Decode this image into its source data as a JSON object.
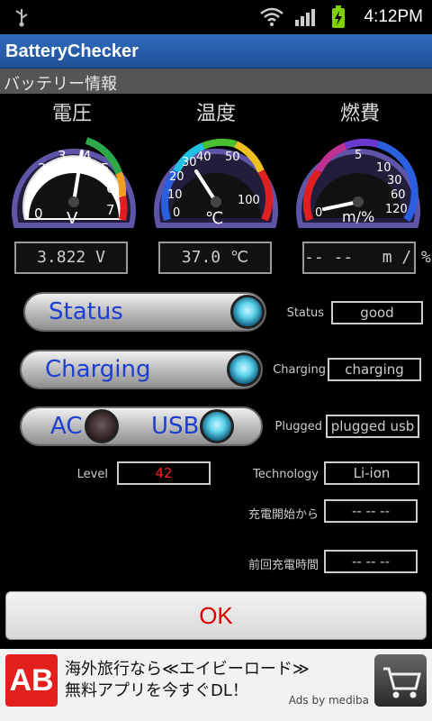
{
  "status_bar": {
    "time": "4:12PM",
    "icons": [
      "usb-icon",
      "wifi-icon",
      "signal-icon",
      "battery-charging-icon"
    ]
  },
  "app": {
    "title": "BatteryChecker",
    "section": "バッテリー情報"
  },
  "gauges": [
    {
      "label": "電圧",
      "unit": "V",
      "ticks": [
        "0",
        "1",
        "2",
        "3",
        "4",
        "5",
        "6",
        "7"
      ],
      "readout": "3.822 V",
      "value": 3.822,
      "min": 0,
      "max": 7
    },
    {
      "label": "温度",
      "unit": "℃",
      "ticks": [
        "0",
        "10",
        "20",
        "30",
        "40",
        "50",
        "100"
      ],
      "readout": "37.0 ℃",
      "value": 37.0,
      "min": 0,
      "max": 100
    },
    {
      "label": "燃費",
      "unit": "m/%",
      "ticks": [
        "0",
        "5",
        "10",
        "30",
        "60",
        "120"
      ],
      "readout": "-- --   m / %"
    }
  ],
  "toggles": {
    "status": {
      "label": "Status",
      "on": true
    },
    "charging": {
      "label": "Charging",
      "on": true
    },
    "plugged": {
      "ac_label": "AC",
      "usb_label": "USB",
      "ac_on": false,
      "usb_on": true
    }
  },
  "fields": {
    "status": {
      "label": "Status",
      "value": "good"
    },
    "charging": {
      "label": "Charging",
      "value": "charging"
    },
    "plugged": {
      "label": "Plugged",
      "value": "plugged usb"
    },
    "level": {
      "label": "Level",
      "value": "42"
    },
    "technology": {
      "label": "Technology",
      "value": "Li-ion"
    },
    "since_charge": {
      "label": "充電開始から",
      "value": "-- -- --"
    },
    "last_charge": {
      "label": "前回充電時間",
      "value": "-- -- --"
    }
  },
  "ok_button": {
    "label": "OK"
  },
  "ad": {
    "logo": "AB",
    "line1": "海外旅行なら≪エイビーロード≫",
    "line2": "無料アプリを今すぐDL！",
    "by": "Ads by mediba"
  },
  "colors": {
    "titlebar": "#2f6dbd",
    "level_value": "#ff2222",
    "ok_text": "#e00000",
    "toggle_label": "#1d3fd1"
  }
}
